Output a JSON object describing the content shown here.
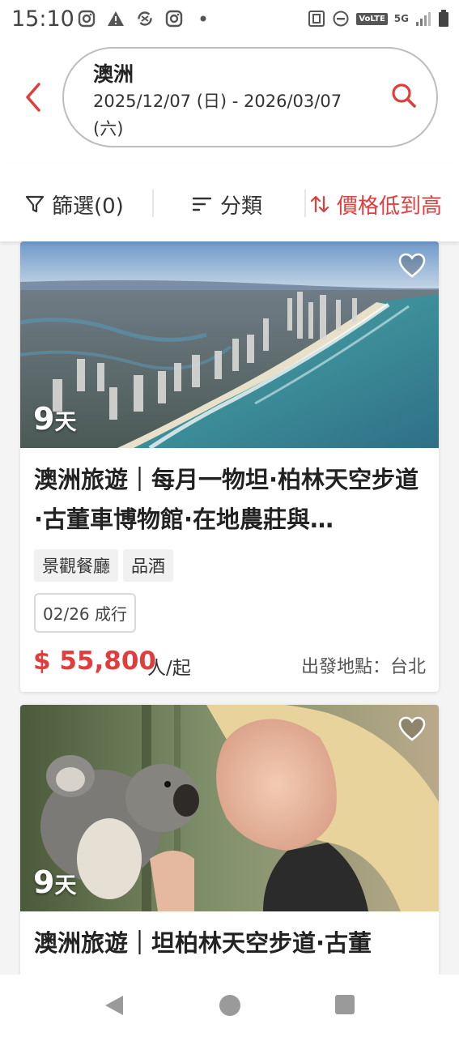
{
  "status_bar": {
    "time": "15:10",
    "left_icons": [
      "instagram-icon",
      "warning-icon",
      "sync-icon",
      "instagram-icon",
      "dot-icon"
    ],
    "right_icons": [
      "nfc-icon",
      "dnd-icon",
      "volte-icon",
      "5g-icon",
      "signal-icon",
      "battery-icon"
    ],
    "volte_label": "VoLTE",
    "network_label": "5G"
  },
  "search": {
    "destination": "澳洲",
    "dates": "2025/12/07 (日) - 2026/03/07 (六)"
  },
  "filter_bar": {
    "filter_label": "篩選(0)",
    "sort_label": "分類",
    "price_sort_label": "價格低到高"
  },
  "colors": {
    "accent": "#e23d3d",
    "border": "#bdbdbd"
  },
  "tours": [
    {
      "days_num": "9",
      "days_unit": "天",
      "title": "澳洲旅遊｜每月一物坦·柏林天空步道·古董車博物館·在地農莊與…",
      "tags": [
        "景觀餐廳",
        "品酒"
      ],
      "departure": "02/26 成行",
      "price": "$ 55,800",
      "price_unit": "人/起",
      "origin": "出發地點：台北"
    },
    {
      "days_num": "9",
      "days_unit": "天",
      "title": "澳洲旅遊｜坦柏林天空步道·古董"
    }
  ],
  "nav": [
    "back-icon",
    "home-icon",
    "recents-icon"
  ]
}
